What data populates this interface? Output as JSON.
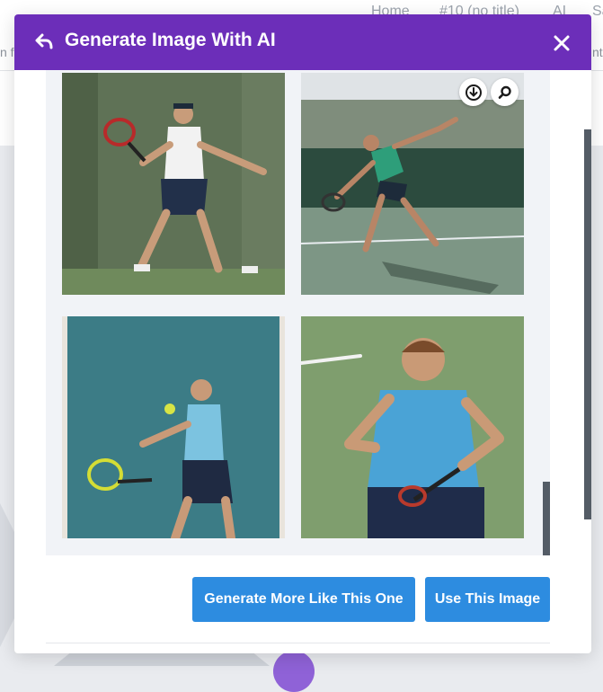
{
  "background": {
    "nav": [
      "Home",
      "#10 (no title)",
      "AI",
      "Sa"
    ],
    "left_fragment": "n fe",
    "right_fragment": "nt"
  },
  "modal": {
    "title": "Generate Image With AI",
    "back_icon": "undo-arrow-icon",
    "close_icon": "close-icon",
    "tool_icons": [
      "download-icon",
      "search-icon"
    ],
    "images": [
      "tennis-player-white-shirt",
      "tennis-player-green-shirt-court",
      "tennis-player-blue-shirt-teal-bg",
      "tennis-player-blue-polo-closeup"
    ],
    "buttons": {
      "generate_more": "Generate More Like This One",
      "use_image": "Use This Image"
    }
  },
  "colors": {
    "header": "#6c2eb9",
    "button": "#2d8ce0",
    "gallery_bg": "#f1f3f7"
  }
}
